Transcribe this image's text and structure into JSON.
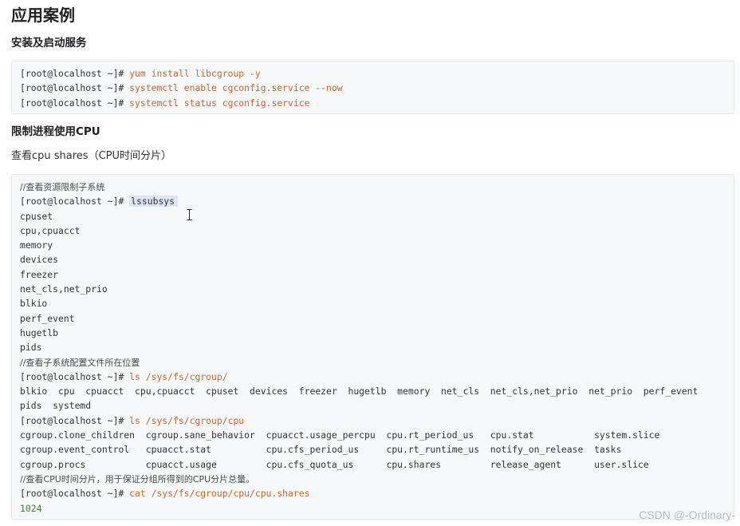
{
  "heading": "应用案例",
  "section1": {
    "title": "安装及启动服务",
    "code": [
      {
        "prompt": "[root@localhost ~]# ",
        "cmd": "yum install libcgroup -y"
      },
      {
        "prompt": "[root@localhost ~]# ",
        "cmd": "systemctl enable cgconfig.service --now"
      },
      {
        "prompt": "[root@localhost ~]# ",
        "cmd": "systemctl status cgconfig.service"
      }
    ]
  },
  "section2": {
    "title": "限制进程使用CPU",
    "subtitle": "查看cpu shares（CPU时间分片）",
    "code": [
      {
        "type": "comment",
        "text": "//查看资源限制子系统"
      },
      {
        "type": "command",
        "prompt": "[root@localhost ~]# ",
        "cmd": "lssubsys"
      },
      {
        "type": "output",
        "text": "cpuset"
      },
      {
        "type": "output",
        "text": "cpu,cpuacct"
      },
      {
        "type": "output",
        "text": "memory"
      },
      {
        "type": "output",
        "text": "devices"
      },
      {
        "type": "output",
        "text": "freezer"
      },
      {
        "type": "output",
        "text": "net_cls,net_prio"
      },
      {
        "type": "output",
        "text": "blkio"
      },
      {
        "type": "output",
        "text": "perf_event"
      },
      {
        "type": "output",
        "text": "hugetlb"
      },
      {
        "type": "output",
        "text": "pids"
      },
      {
        "type": "comment",
        "text": "//查看子系统配置文件所在位置"
      },
      {
        "type": "command",
        "prompt": "[root@localhost ~]# ",
        "cmd": "ls /sys/fs/cgroup/"
      },
      {
        "type": "output",
        "text": "blkio  cpu  cpuacct  cpu,cpuacct  cpuset  devices  freezer  hugetlb  memory  net_cls  net_cls,net_prio  net_prio  perf_event"
      },
      {
        "type": "output",
        "text": "pids  systemd"
      },
      {
        "type": "command",
        "prompt": "[root@localhost ~]# ",
        "cmd": "ls /sys/fs/cgroup/cpu"
      },
      {
        "type": "output",
        "text": "cgroup.clone_children  cgroup.sane_behavior  cpuacct.usage_percpu  cpu.rt_period_us   cpu.stat           system.slice"
      },
      {
        "type": "output",
        "text": "cgroup.event_control   cpuacct.stat          cpu.cfs_period_us     cpu.rt_runtime_us  notify_on_release  tasks"
      },
      {
        "type": "output",
        "text": "cgroup.procs           cpuacct.usage         cpu.cfs_quota_us      cpu.shares         release_agent      user.slice"
      },
      {
        "type": "comment",
        "text": "//查看CPU时间分片，用于保证分组所得到的CPU分片总量。"
      },
      {
        "type": "command",
        "prompt": "[root@localhost ~]# ",
        "cmd": "cat /sys/fs/cgroup/cpu/cpu.shares"
      },
      {
        "type": "output-green",
        "text": "1024"
      }
    ]
  },
  "watermark": "CSDN @-Ordinary-",
  "colors": {
    "command": "#c7672b",
    "code_bg": "#f6f8fa",
    "highlight_bg": "#dbe6f0"
  }
}
